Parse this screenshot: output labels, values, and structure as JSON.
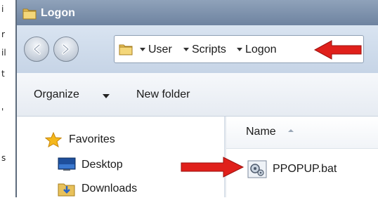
{
  "background": {
    "fragments": [
      "i",
      "r",
      "il",
      "t",
      "'",
      "s"
    ]
  },
  "window": {
    "title": "Logon",
    "accent": "#6e83a0"
  },
  "address_bar": {
    "crumbs": [
      "User",
      "Scripts",
      "Logon"
    ]
  },
  "toolbar": {
    "organize_label": "Organize",
    "new_folder_label": "New folder"
  },
  "nav_pane": {
    "items": [
      {
        "label": "Favorites",
        "icon": "star-icon"
      },
      {
        "label": "Desktop",
        "icon": "desktop-icon"
      },
      {
        "label": "Downloads",
        "icon": "downloads-folder-icon"
      }
    ]
  },
  "columns": {
    "name_label": "Name"
  },
  "files": [
    {
      "name": "PPOPUP.bat",
      "icon": "batch-file-icon"
    }
  ],
  "annotations": {
    "arrow_color": "#e0201b"
  }
}
